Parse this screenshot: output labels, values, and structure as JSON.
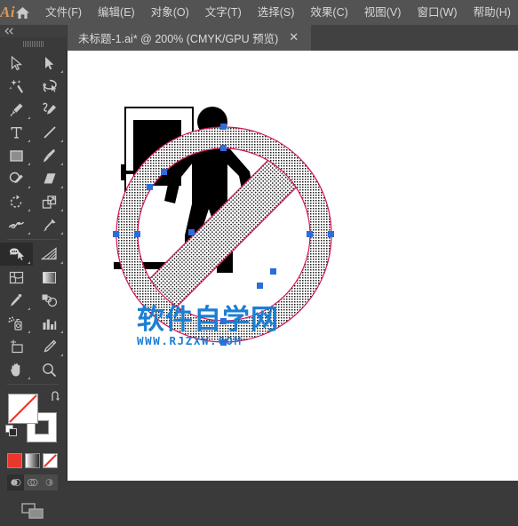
{
  "app": {
    "name": "Ai",
    "logo_color": "#d79a5b",
    "home_icon": "home-icon"
  },
  "menubar": {
    "items": [
      {
        "label": "文件(F)",
        "name": "menu-file"
      },
      {
        "label": "编辑(E)",
        "name": "menu-edit"
      },
      {
        "label": "对象(O)",
        "name": "menu-object"
      },
      {
        "label": "文字(T)",
        "name": "menu-type"
      },
      {
        "label": "选择(S)",
        "name": "menu-select"
      },
      {
        "label": "效果(C)",
        "name": "menu-effect"
      },
      {
        "label": "视图(V)",
        "name": "menu-view"
      },
      {
        "label": "窗口(W)",
        "name": "menu-window"
      },
      {
        "label": "帮助(H)",
        "name": "menu-help"
      }
    ]
  },
  "tabbar": {
    "tab_title": "未标题-1.ai* @ 200% (CMYK/GPU 预览)",
    "close_label": "✕",
    "zoom_level": "200%",
    "color_mode": "CMYK",
    "preview_mode": "GPU 预览",
    "document_name": "未标题-1.ai",
    "modified": true
  },
  "toolbar": {
    "collapse_icon": "double-chevron-left-icon",
    "tools": [
      {
        "name": "selection-tool",
        "icon": "arrow-outline-icon",
        "active": false,
        "has_flyout": false
      },
      {
        "name": "direct-selection-tool",
        "icon": "arrow-filled-icon",
        "active": false,
        "has_flyout": true
      },
      {
        "name": "magic-wand-tool",
        "icon": "magic-wand-icon",
        "active": false,
        "has_flyout": false
      },
      {
        "name": "lasso-tool",
        "icon": "lasso-icon",
        "active": false,
        "has_flyout": false
      },
      {
        "name": "pen-tool",
        "icon": "pen-icon",
        "active": false,
        "has_flyout": true
      },
      {
        "name": "curvature-tool",
        "icon": "curvature-pen-icon",
        "active": false,
        "has_flyout": false
      },
      {
        "name": "type-tool",
        "icon": "type-t-icon",
        "active": false,
        "has_flyout": true
      },
      {
        "name": "line-segment-tool",
        "icon": "line-icon",
        "active": false,
        "has_flyout": true
      },
      {
        "name": "rectangle-tool",
        "icon": "rectangle-icon",
        "active": false,
        "has_flyout": true
      },
      {
        "name": "paintbrush-tool",
        "icon": "paintbrush-icon",
        "active": false,
        "has_flyout": true
      },
      {
        "name": "shaper-tool",
        "icon": "shaper-pencil-icon",
        "active": false,
        "has_flyout": true
      },
      {
        "name": "eraser-tool",
        "icon": "eraser-icon",
        "active": false,
        "has_flyout": true
      },
      {
        "name": "rotate-tool",
        "icon": "rotate-icon",
        "active": false,
        "has_flyout": true
      },
      {
        "name": "scale-tool",
        "icon": "scale-icon",
        "active": false,
        "has_flyout": true
      },
      {
        "name": "width-tool",
        "icon": "width-icon",
        "active": false,
        "has_flyout": true
      },
      {
        "name": "free-transform-tool",
        "icon": "pushpin-icon",
        "active": false,
        "has_flyout": true
      },
      {
        "name": "shape-builder-tool",
        "icon": "shape-builder-icon",
        "active": true,
        "has_flyout": true
      },
      {
        "name": "perspective-grid-tool",
        "icon": "perspective-grid-icon",
        "active": false,
        "has_flyout": true
      },
      {
        "name": "mesh-tool",
        "icon": "mesh-icon",
        "active": false,
        "has_flyout": false
      },
      {
        "name": "gradient-tool",
        "icon": "gradient-icon",
        "active": false,
        "has_flyout": false
      },
      {
        "name": "eyedropper-tool",
        "icon": "eyedropper-icon",
        "active": false,
        "has_flyout": true
      },
      {
        "name": "blend-tool",
        "icon": "blend-icon",
        "active": false,
        "has_flyout": false
      },
      {
        "name": "symbol-sprayer-tool",
        "icon": "symbol-sprayer-icon",
        "active": false,
        "has_flyout": true
      },
      {
        "name": "column-graph-tool",
        "icon": "bar-chart-icon",
        "active": false,
        "has_flyout": true
      },
      {
        "name": "artboard-tool",
        "icon": "artboard-icon",
        "active": false,
        "has_flyout": false
      },
      {
        "name": "slice-tool",
        "icon": "slice-knife-icon",
        "active": false,
        "has_flyout": true
      },
      {
        "name": "hand-tool",
        "icon": "hand-icon",
        "active": false,
        "has_flyout": true
      },
      {
        "name": "zoom-tool",
        "icon": "magnifier-icon",
        "active": false,
        "has_flyout": false
      }
    ],
    "fill_color": "#ffffff",
    "fill_is_none": true,
    "stroke_color": "#e8382e",
    "swap_icon": "swap-fill-stroke-icon",
    "default_icon": "default-fill-stroke-icon",
    "color_modes": [
      {
        "name": "color-mode-button",
        "label": "color",
        "swatch": "#e8382e",
        "active": false
      },
      {
        "name": "gradient-mode-button",
        "label": "gradient",
        "swatch": "#ffffff",
        "active": false
      },
      {
        "name": "none-mode-button",
        "label": "none",
        "swatch": "#2b2b2b",
        "active": true
      }
    ],
    "draw_modes": [
      {
        "name": "draw-normal-button",
        "icon": "draw-normal-icon",
        "active": true
      },
      {
        "name": "draw-behind-button",
        "icon": "draw-behind-icon",
        "active": false
      },
      {
        "name": "draw-inside-button",
        "icon": "draw-inside-icon",
        "active": false
      }
    ],
    "screen_mode": {
      "name": "change-screen-mode-button",
      "icon": "screen-mode-icon"
    }
  },
  "canvas": {
    "background": "#ffffff",
    "artwork": {
      "name": "no-entry-sign-artwork",
      "description": "prohibition sign with walking person and door",
      "outer_circle_color": "#000000",
      "figure_color": "#000000",
      "path_outline_color": "#d4145a",
      "anchor_color": "#2b6ed9",
      "selected": true
    },
    "watermark": {
      "text_cn": "软件自学网",
      "text_url": "WWW.RJZXW.COM",
      "color": "#1b7fd4"
    }
  }
}
